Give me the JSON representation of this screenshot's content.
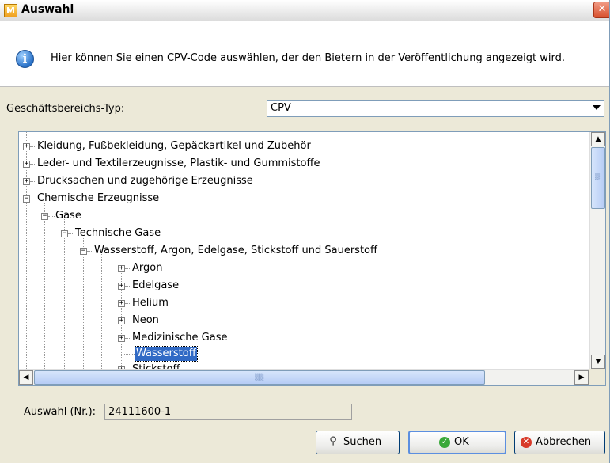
{
  "window": {
    "title": "Auswahl",
    "app_icon": "app-icon",
    "close_label": "✕"
  },
  "info": {
    "icon": "info-icon",
    "text": "Hier können Sie einen CPV-Code auswählen, der den Bietern in der Veröffentlichung angezeigt wird."
  },
  "business_type": {
    "label": "Geschäftsbereichs-Typ:",
    "value": "CPV"
  },
  "tree": {
    "nodes": [
      {
        "label": "Kleidung, Fußbekleidung, Gepäckartikel und Zubehör",
        "state": "collapsed"
      },
      {
        "label": "Leder- und Textilerzeugnisse, Plastik- und Gummistoffe",
        "state": "collapsed"
      },
      {
        "label": "Drucksachen und zugehörige Erzeugnisse",
        "state": "collapsed"
      },
      {
        "label": "Chemische Erzeugnisse",
        "state": "expanded"
      },
      {
        "label": "Gase",
        "state": "expanded"
      },
      {
        "label": "Technische Gase",
        "state": "expanded"
      },
      {
        "label": "Wasserstoff, Argon, Edelgase, Stickstoff und Sauerstoff",
        "state": "expanded"
      },
      {
        "label": "Argon",
        "state": "collapsed"
      },
      {
        "label": "Edelgase",
        "state": "collapsed"
      },
      {
        "label": "Helium",
        "state": "collapsed"
      },
      {
        "label": "Neon",
        "state": "collapsed"
      },
      {
        "label": "Medizinische Gase",
        "state": "collapsed"
      },
      {
        "label": "Wasserstoff",
        "state": "leaf",
        "selected": true
      },
      {
        "label": "Stickstoff",
        "state": "collapsed"
      }
    ]
  },
  "selection": {
    "label": "Auswahl (Nr.):",
    "value": "24111600-1"
  },
  "buttons": {
    "search": {
      "prefix": "",
      "mnemonic": "S",
      "rest": "uchen",
      "icon": "magnifier-icon"
    },
    "ok": {
      "prefix": "",
      "mnemonic": "O",
      "rest": "K",
      "icon": "check-icon"
    },
    "cancel": {
      "prefix": "",
      "mnemonic": "A",
      "rest": "bbrechen",
      "icon": "cancel-icon"
    }
  },
  "colors": {
    "selection_bg": "#316ac5",
    "ok_icon": "#3aa83a",
    "cancel_icon": "#d83a2a"
  }
}
